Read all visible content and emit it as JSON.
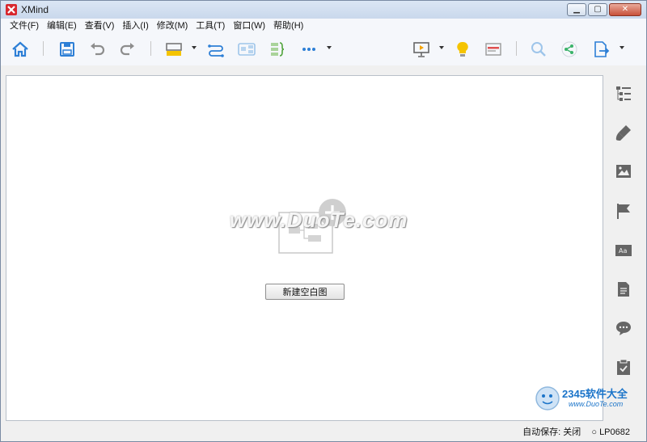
{
  "window": {
    "title": "XMind"
  },
  "menu": {
    "items": [
      "文件(F)",
      "编辑(E)",
      "查看(V)",
      "插入(I)",
      "修改(M)",
      "工具(T)",
      "窗口(W)",
      "帮助(H)"
    ]
  },
  "toolbar": {
    "icons": [
      "home-icon",
      "save-icon",
      "undo-icon",
      "redo-icon",
      "topic-style-icon",
      "relationship-icon",
      "boundary-icon",
      "summary-icon",
      "more-icon",
      "presentation-icon",
      "idea-icon",
      "layout-icon",
      "search-icon",
      "share-icon",
      "export-icon"
    ]
  },
  "sidebar": {
    "icons": [
      "outline-icon",
      "format-brush-icon",
      "image-icon",
      "marker-flag-icon",
      "text-style-icon",
      "notes-icon",
      "comments-icon",
      "task-icon"
    ]
  },
  "main": {
    "new_blank_button": "新建空白图",
    "watermark": "www.DuoTe.com"
  },
  "status": {
    "autosave": "自动保存: 关闭",
    "user": "LP0682"
  },
  "corner_logo": {
    "brand": "2345软件大全",
    "site": "www.DuoTe.com"
  },
  "colors": {
    "accent_blue": "#2d7fd6",
    "logo_red": "#d8282e",
    "icon_gray": "#6b6b6b",
    "bulb_yellow": "#f5c400",
    "share_green": "#3bb36a"
  }
}
